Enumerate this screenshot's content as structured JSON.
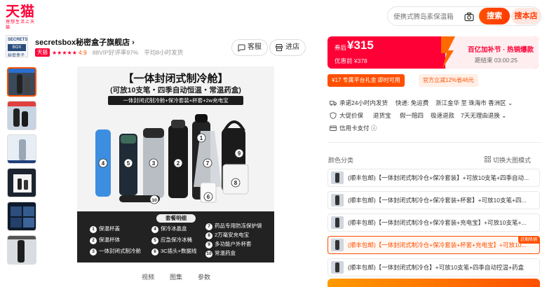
{
  "header": {
    "logo_main": "天猫",
    "logo_sub": "理想生活上天猫",
    "search_placeholder": "便携式腾岛素保温箱",
    "search_button": "搜索",
    "store_search_button": "搜本店"
  },
  "store": {
    "logo_line1": "SECRETS",
    "logo_line2": "BOX",
    "logo_line3": "秘密盒子",
    "name": "secretsbox秘密盒子旗舰店 ›",
    "tag": "天猫",
    "stars": "★★★★★",
    "rating": "4.9",
    "good_rate": "88VIP好评率97%",
    "ship_time": "平均8小时发货",
    "service_button": "客服",
    "enter_store_button": "进店"
  },
  "gallery": {
    "hero_title": "【一体封闭式制冷舱】",
    "hero_subtitle": "(可放10支笔・四季自动恒温・常温药盒)",
    "hero_band": "一体封闭式制冷舱+保冷套装+杯套+2w充电宝",
    "package_title": "套餐明细",
    "package_items": [
      {
        "num": "1",
        "label": "保温杯盖"
      },
      {
        "num": "2",
        "label": "保温杯体"
      },
      {
        "num": "3",
        "label": "一体封闭式制冷舱"
      },
      {
        "num": "4",
        "label": "保冷冰晶盒"
      },
      {
        "num": "5",
        "label": "应急保冷冰桶"
      },
      {
        "num": "6",
        "label": "3C插头+数据线"
      },
      {
        "num": "7",
        "label": "药品专用防冻保护袋"
      },
      {
        "num": "8",
        "label": "2万毫安充电宝"
      },
      {
        "num": "9",
        "label": "多功能户外杯套"
      },
      {
        "num": "10",
        "label": "常温药盒"
      }
    ],
    "product_labels": [
      "4",
      "5",
      "3",
      "2",
      "1",
      "7",
      "9",
      "8",
      "6",
      "10"
    ],
    "media_tabs": [
      "视频",
      "图集",
      "参数"
    ]
  },
  "promo": {
    "price_label": "券后",
    "price_value": "¥315",
    "original_price": "优惠前 ¥378",
    "event_title": "百亿加补节 · 热销爆款",
    "countdown": "距结束 03:00:25"
  },
  "coupons": {
    "coupon1": "¥17  专属平台礼金 即时可用",
    "coupon2": "官方立减12%省46元"
  },
  "services": {
    "line1_a": "承诺24小时内发货",
    "line1_b": "快递: 免运费",
    "line1_c": "浙江金华 至 珠海市 香洲区 ⌄",
    "line2_a": "大促价保",
    "line2_b": "退货宝",
    "line2_c": "假一赔四",
    "line2_d": "极速退款",
    "line2_e": "7天无理由退换 ⌄",
    "line3": "信用卡支付 ⓘ"
  },
  "options": {
    "label": "颜色分类",
    "switch_mode": "切换大图模式",
    "items": [
      {
        "text": "(顺丰包邮)【一体封闭式制冷仓+保冷套装】+可放10支笔+四季自动...",
        "badge": ""
      },
      {
        "text": "(顺丰包邮)【一体封闭式制冷仓+保冷套装+杯套】+可放10支笔+四...",
        "badge": ""
      },
      {
        "text": "(顺丰包邮)【一体封闭式制冷仓+保冷套装+充电宝】+可放10支笔+...",
        "badge": ""
      },
      {
        "text": "(顺丰包邮)【一体封闭式制冷仓+保冷套装+杯套+充电宝】+可放10...",
        "badge": "近期热销"
      },
      {
        "text": "(顺丰包邮)【一体封闭式制冷仓】+可放10支笔+四季自动控温+药盒",
        "badge": ""
      }
    ]
  },
  "colors": {
    "accent": "#ff5000",
    "brand": "#ff0036"
  }
}
